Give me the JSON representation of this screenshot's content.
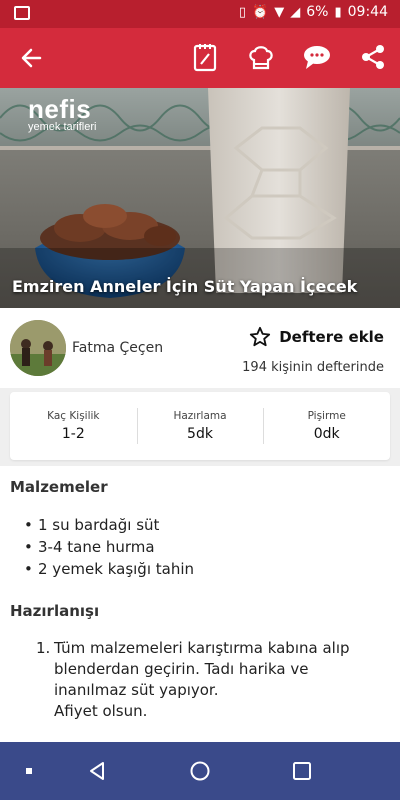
{
  "status_bar": {
    "battery": "6%",
    "time": "09:44"
  },
  "app_bar": {
    "icons": [
      "back-arrow-icon",
      "notebook-icon",
      "chef-hat-icon",
      "comment-icon",
      "share-icon"
    ]
  },
  "hero": {
    "brand_name": "nefis",
    "brand_sub": "yemek tarifleri",
    "title": "Emziren Anneler İçin Süt Yapan İçecek"
  },
  "author": {
    "name": "Fatma Çeçen",
    "add_label": "Deftere ekle",
    "count_text": "194 kişinin defterinde"
  },
  "stats": [
    {
      "label": "Kaç Kişilik",
      "value": "1-2"
    },
    {
      "label": "Hazırlama",
      "value": "5dk"
    },
    {
      "label": "Pişirme",
      "value": "0dk"
    }
  ],
  "ingredients": {
    "heading": "Malzemeler",
    "items": [
      "1 su bardağı süt",
      "3-4 tane hurma",
      "2 yemek kaşığı tahin"
    ]
  },
  "preparation": {
    "heading": "Hazırlanışı",
    "steps": [
      {
        "num": "1.",
        "lines": [
          "Tüm malzemeleri karıştırma kabına alıp",
          "blenderdan geçirin. Tadı harika ve",
          "inanılmaz süt yapıyor.",
          "Afiyet olsun."
        ]
      }
    ]
  },
  "colors": {
    "status_bar": "#b81f2e",
    "app_bar": "#d42b3c",
    "nav_bar": "#3a4a8a"
  }
}
